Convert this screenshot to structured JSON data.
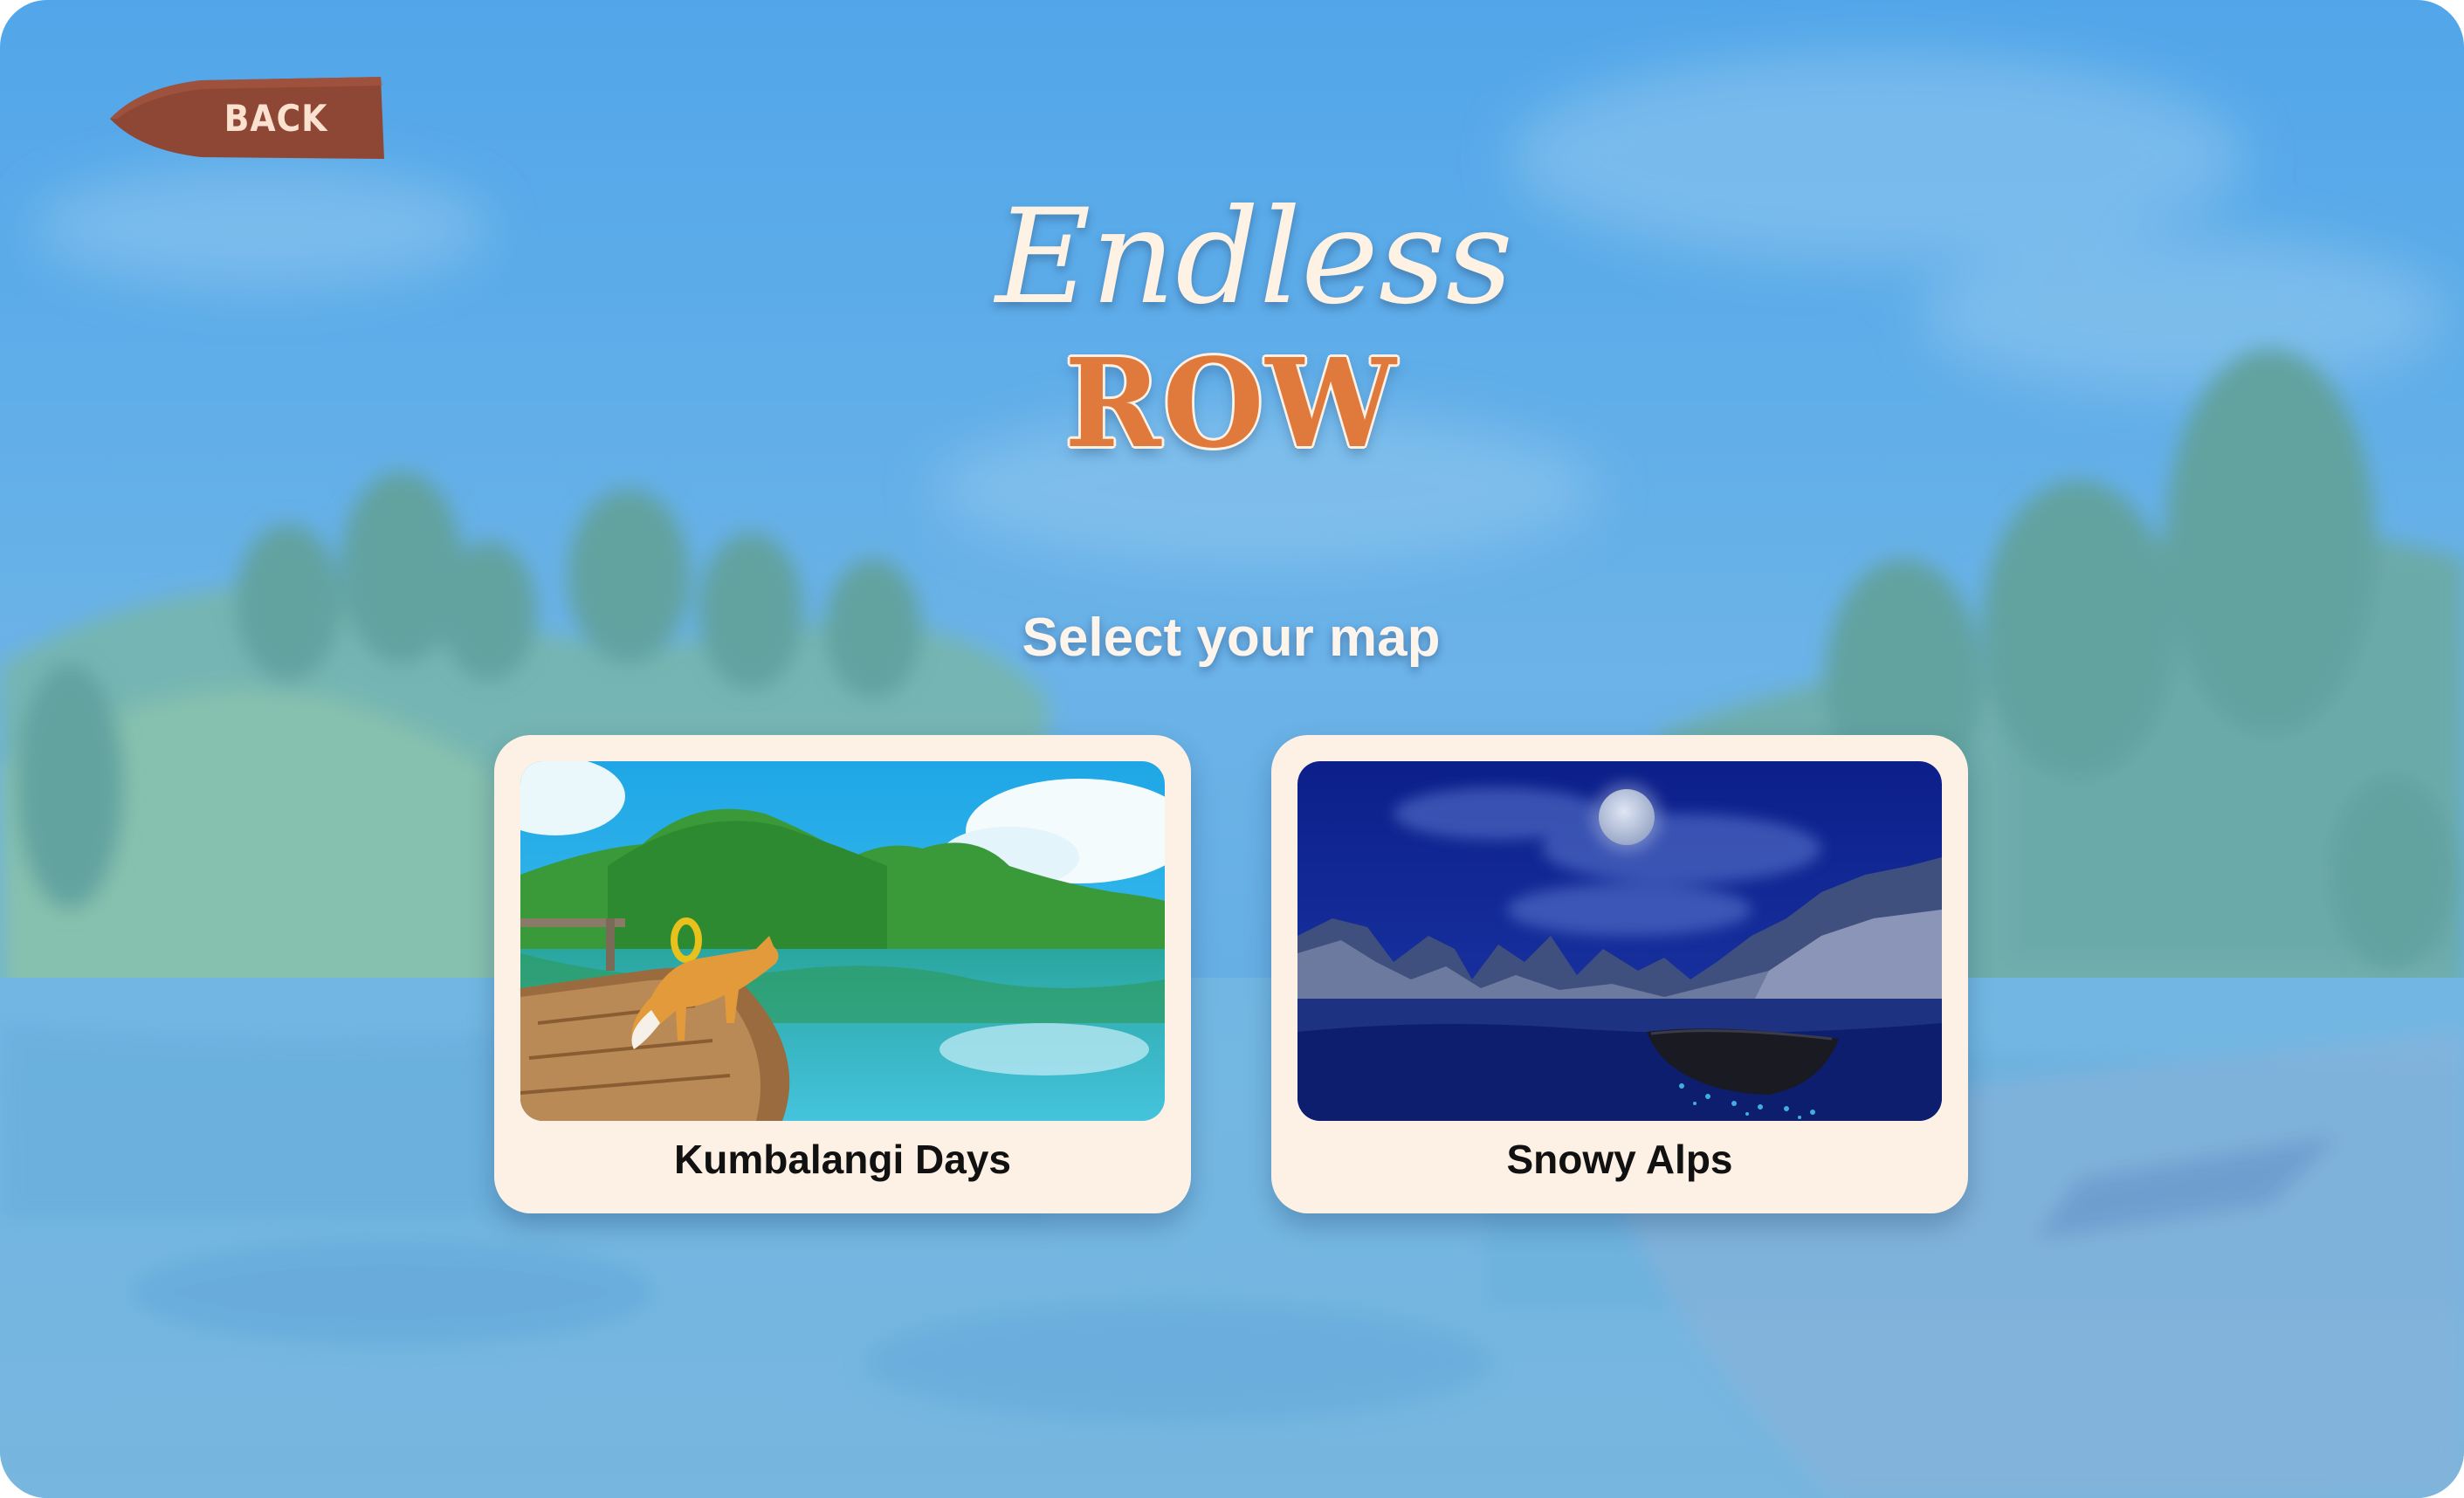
{
  "game": {
    "title_script": "Endless",
    "title_block": "ROW",
    "subtitle": "Select your map"
  },
  "back_button": {
    "label": "BACK"
  },
  "maps": [
    {
      "name": "Kumbalangi Days",
      "thumbnail": "sunny-lake-fox-boat"
    },
    {
      "name": "Snowy Alps",
      "thumbnail": "moonlit-lake-boat"
    }
  ],
  "colors": {
    "sky": "#4ea6e8",
    "back_button": "#8f4735",
    "back_text": "#fbe1cf",
    "logo_script": "#fdf2e3",
    "logo_block": "#e07a3c",
    "card_bg": "#fdf1e5",
    "card_text": "#111111"
  }
}
